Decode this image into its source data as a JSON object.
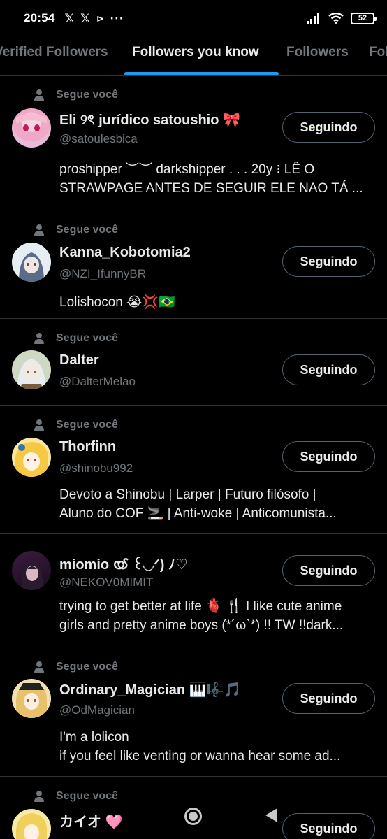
{
  "status_bar": {
    "time": "20:54",
    "battery": "52",
    "left_icons": [
      "x-logo-icon",
      "x-logo-icon",
      "play-icon",
      "more-icon"
    ],
    "right_icons": [
      "signal-icon",
      "wifi-icon",
      "battery-icon"
    ]
  },
  "tabs": [
    {
      "label": "Verified Followers",
      "active": false
    },
    {
      "label": "Followers you know",
      "active": true
    },
    {
      "label": "Followers",
      "active": false
    },
    {
      "label": "Following",
      "active": false
    }
  ],
  "accent_color": "#1d9bf0",
  "users": [
    {
      "follows_you": "Segue você",
      "name": "Eli ୨ৎ jurídico satoushio 🎀",
      "handle": "@satoulesbica",
      "bio": [
        "proshipper ︶︶ darkshipper . . . 20y ⁝ LÊ O",
        "STRAWPAGE ANTES DE SEGUIR ELE NAO TÁ ..."
      ],
      "button": "Seguindo"
    },
    {
      "follows_you": "Segue você",
      "name": "Kanna_Kobotomia2",
      "handle": "@NZI_IfunnyBR",
      "bio": [
        "Lolishocon 😭💢🇧🇷"
      ],
      "button": "Seguindo"
    },
    {
      "follows_you": "Segue você",
      "name": "Dalter",
      "handle": "@DalterMelao",
      "bio": [],
      "button": "Seguindo"
    },
    {
      "follows_you": "Segue você",
      "name": "Thorfinn",
      "handle": "@shinobu992",
      "bio": [
        "Devoto a Shinobu | Larper | Futuro filósofo |",
        "Aluno do COF 🚬 | Anti-woke | Anticomunista..."
      ],
      "button": "Seguindo"
    },
    {
      "follows_you": "",
      "name": "miomio ൕ ꒰◡ᐟ) ﾉ♡",
      "handle": "@NEKOV0MIMIT",
      "bio": [
        "trying to get better at life 🫀 🍴 I like cute anime",
        "girls and pretty anime boys (*´ω`*) !! TW !!dark..."
      ],
      "button": "Seguindo"
    },
    {
      "follows_you": "Segue você",
      "name": "Ordinary_Magician 🎹🎼🎵",
      "handle": "@OdMagician",
      "bio": [
        "I'm a lolicon",
        "if you feel like venting or wanna hear some ad..."
      ],
      "button": "Seguindo"
    },
    {
      "follows_you": "Segue você",
      "name": "カイオ 🩷",
      "handle": "",
      "bio": [],
      "button": "Seguindo"
    }
  ]
}
